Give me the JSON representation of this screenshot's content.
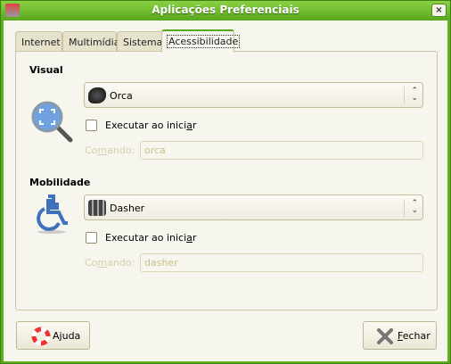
{
  "window": {
    "title": "Aplicações Preferenciais",
    "close_label": "×"
  },
  "tabs": [
    {
      "label": "Internet"
    },
    {
      "label": "Multimídia"
    },
    {
      "label": "Sistema"
    },
    {
      "label": "Acessibilidade",
      "active": true
    }
  ],
  "visual": {
    "heading": "Visual",
    "app": "Orca",
    "icon": "magnifier-icon",
    "run_at_start": {
      "pre": "Executar ao inici",
      "u": "a",
      "post": "r",
      "checked": false
    },
    "command": {
      "pre": "Co",
      "u": "m",
      "post": "ando:",
      "value": "orca"
    }
  },
  "mobility": {
    "heading": "Mobilidade",
    "app": "Dasher",
    "icon": "wheelchair-icon",
    "run_at_start": {
      "pre": "Executar ao inici",
      "u": "a",
      "post": "r",
      "checked": false
    },
    "command": {
      "pre": "Co",
      "u": "m",
      "post": "ando:",
      "value": "dasher"
    }
  },
  "buttons": {
    "help": {
      "pre": "A",
      "u": "j",
      "post": "uda"
    },
    "close": {
      "pre": "",
      "u": "F",
      "post": "echar"
    }
  },
  "colors": {
    "titlebar": "#5aa51e",
    "background": "#f7f6ee"
  }
}
